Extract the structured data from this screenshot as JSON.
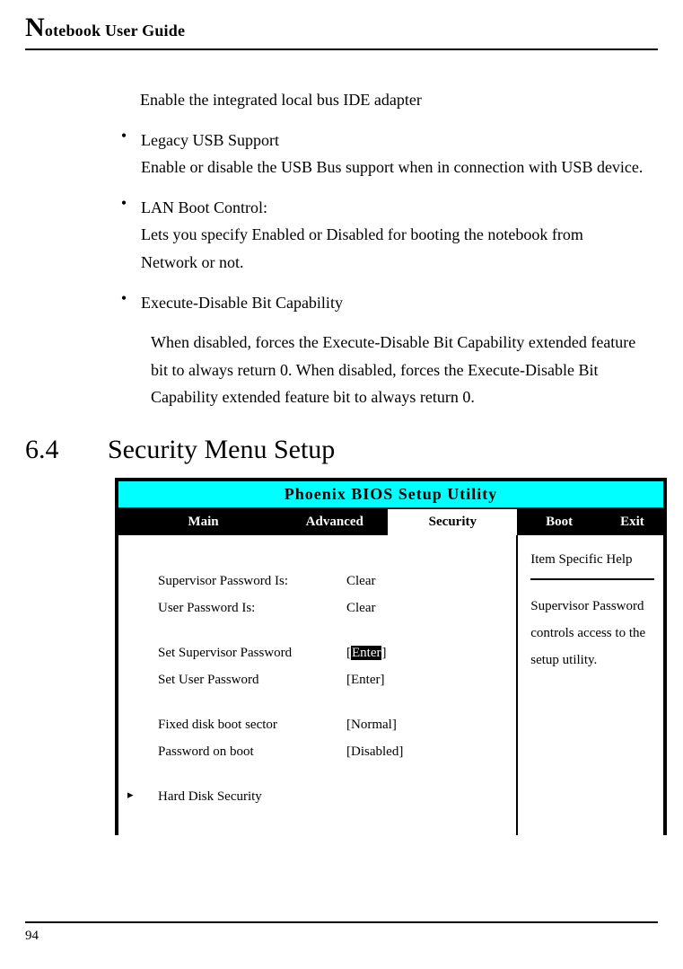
{
  "header": {
    "title_rest": "otebook User Guide"
  },
  "body": {
    "intro": "Enable the integrated local bus IDE adapter",
    "bullets": [
      {
        "title": "Legacy USB Support",
        "desc": "Enable or disable the USB Bus support when in connection with USB device."
      },
      {
        "title": "LAN Boot Control:",
        "desc": "Lets you specify Enabled or Disabled for booting the notebook from Network or not."
      },
      {
        "title": "Execute-Disable Bit Capability",
        "desc": "When disabled, forces the Execute-Disable Bit Capability extended feature bit to always return 0. When disabled, forces the Execute-Disable Bit Capability extended feature bit to always return 0."
      }
    ]
  },
  "section": {
    "num": "6.4",
    "title": "Security Menu Setup"
  },
  "bios": {
    "title": "Phoenix BIOS Setup Utility",
    "tabs": {
      "main": "Main",
      "advanced": "Advanced",
      "security": "Security",
      "boot": "Boot",
      "exit": "Exit"
    },
    "rows": {
      "sup_is_label": "Supervisor Password Is:",
      "sup_is_value": "Clear",
      "user_is_label": "User Password Is:",
      "user_is_value": "Clear",
      "set_sup_label": "Set Supervisor Password",
      "set_sup_lb": "[",
      "set_sup_enter": "Enter",
      "set_sup_rb": "]",
      "set_user_label": "Set User Password",
      "set_user_value": "[Enter]",
      "fixed_label": "Fixed disk boot sector",
      "fixed_value": "[Normal]",
      "pw_boot_label": "Password on boot",
      "pw_boot_value": "[Disabled]",
      "hdd_sec_label": "Hard Disk Security",
      "marker": "▸"
    },
    "help": {
      "header": "Item Specific Help",
      "text": "Supervisor Password controls access to the setup utility."
    }
  },
  "footer": {
    "page": "94"
  }
}
